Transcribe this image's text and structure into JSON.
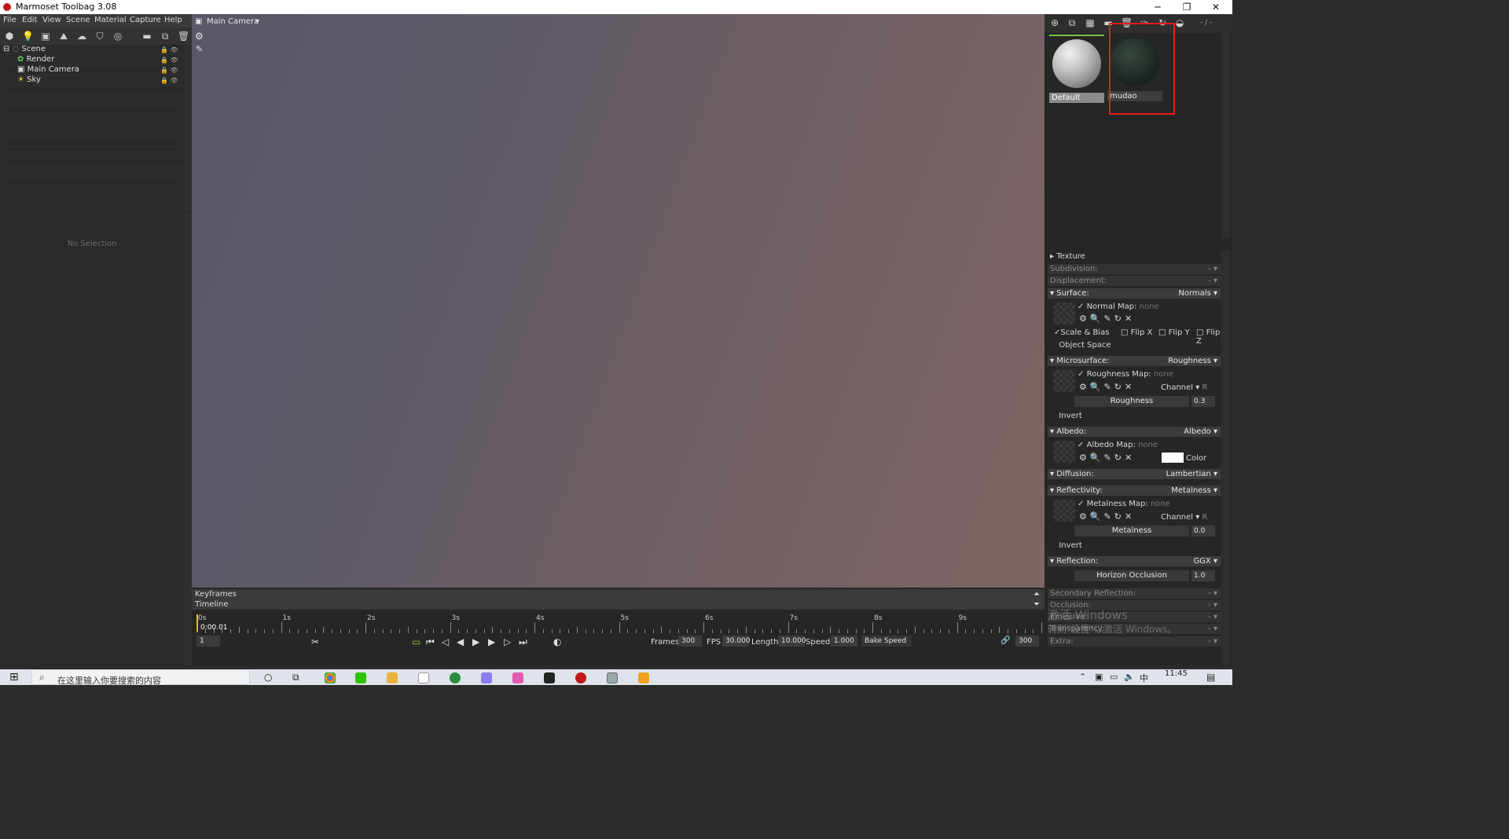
{
  "window": {
    "title": "Marmoset Toolbag 3.08",
    "minimize": "─",
    "restore": "❐",
    "close": "✕"
  },
  "menu": [
    "File",
    "Edit",
    "View",
    "Scene",
    "Material",
    "Capture",
    "Help"
  ],
  "scene_tree": {
    "items": [
      {
        "label": "Scene"
      },
      {
        "label": "Render"
      },
      {
        "label": "Main Camera"
      },
      {
        "label": "Sky"
      }
    ]
  },
  "properties": {
    "empty_text": "No Selection"
  },
  "viewport": {
    "camera_label": "Main Camera",
    "dropdown_arrow": "▾"
  },
  "timeline": {
    "keyframes_label": "Keyframes",
    "timeline_label": "Timeline",
    "ticks": [
      "0s",
      "1s",
      "2s",
      "3s",
      "4s",
      "5s",
      "6s",
      "7s",
      "8s",
      "9s"
    ],
    "current_time": "0:00.01",
    "frame_field": "1",
    "frames_label": "Frames",
    "frames": "300",
    "fps_label": "FPS",
    "fps": "30.000",
    "length_label": "Length",
    "length": "10.000",
    "speed_label": "Speed",
    "speed": "1.000",
    "bake_speed": "Bake Speed",
    "end_frame": "300"
  },
  "materials": {
    "page_indicator": "- / -",
    "items": [
      {
        "name": "Default"
      },
      {
        "name": "mudao"
      }
    ],
    "highlight_color": "#e81b1b"
  },
  "material_props": {
    "texture": "Texture",
    "subdivision": "Subdivision:",
    "subdivision_val": "-",
    "displacement": "Displacement:",
    "displacement_val": "-",
    "surface": "Surface:",
    "surface_val": "Normals",
    "normal_map": "Normal Map:",
    "normal_map_val": "none",
    "scale_bias": "Scale & Bias",
    "flip_x": "Flip X",
    "flip_y": "Flip Y",
    "flip_z": "Flip Z",
    "object_space": "Object Space",
    "microsurface": "Microsurface:",
    "microsurface_val": "Roughness",
    "roughness_map": "Roughness Map:",
    "roughness_map_val": "none",
    "channel": "Channel",
    "channel_val": "R",
    "roughness": "Roughness",
    "roughness_val": "0.3",
    "invert": "Invert",
    "albedo": "Albedo:",
    "albedo_val": "Albedo",
    "albedo_map": "Albedo Map:",
    "albedo_map_val": "none",
    "color": "Color",
    "diffusion": "Diffusion:",
    "diffusion_val": "Lambertian",
    "reflectivity": "Reflectivity:",
    "reflectivity_val": "Metalness",
    "metalness_map": "Metalness Map:",
    "metalness_map_val": "none",
    "metalness": "Metalness",
    "metalness_val": "0.0",
    "reflection": "Reflection:",
    "reflection_val": "GGX",
    "horizon_occlusion": "Horizon Occlusion",
    "horizon_val": "1.0",
    "secondary_reflection": "Secondary Reflection:",
    "occlusion": "Occlusion:",
    "emissive": "Emissive:",
    "transparency": "Transparency:",
    "extra": "Extra:",
    "dash": "-"
  },
  "watermark": {
    "line1": "激活 Windows",
    "line2": "转到\"设置\"以激活 Windows。"
  },
  "taskbar": {
    "search_placeholder": "在这里输入你要搜索的内容",
    "time": "11:45",
    "ime": "中"
  }
}
